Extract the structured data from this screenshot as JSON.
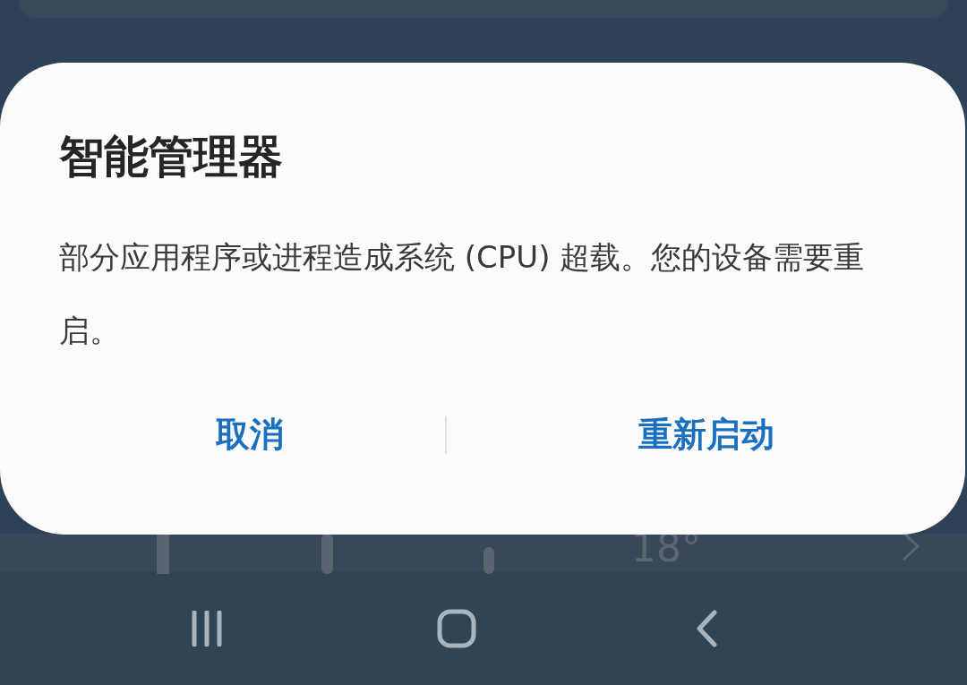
{
  "background": {
    "temperature": "18°"
  },
  "dialog": {
    "title": "智能管理器",
    "message": "部分应用程序或进程造成系统 (CPU) 超载。您的设备需要重启。",
    "buttons": [
      {
        "label": "取消"
      },
      {
        "label": "重新启动"
      }
    ]
  },
  "nav_bar": {
    "buttons": [
      {
        "kind": "recents"
      },
      {
        "kind": "home"
      },
      {
        "kind": "back"
      }
    ]
  }
}
